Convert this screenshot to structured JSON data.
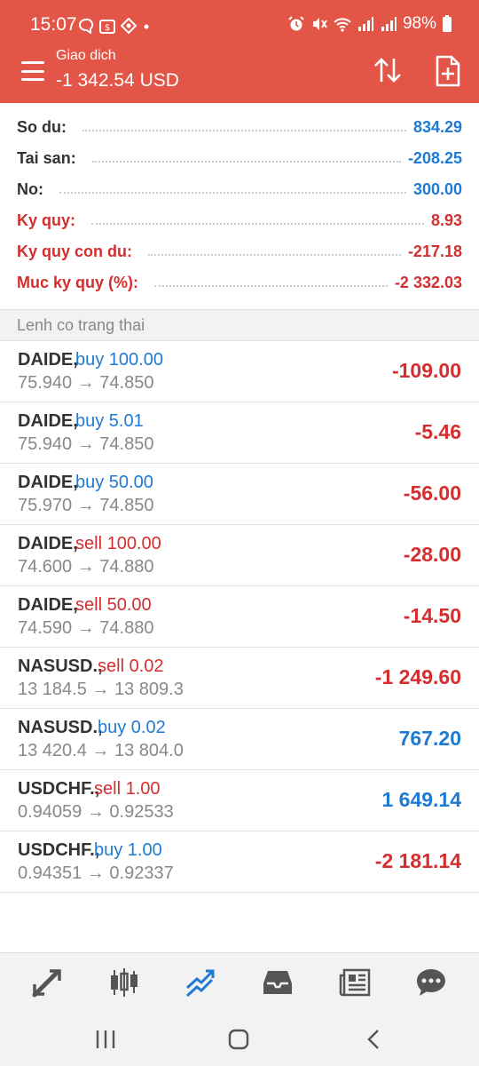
{
  "status_bar": {
    "time": "15:07",
    "battery": "98%",
    "left_icons": [
      "chat-bubble-icon",
      "dollar-app-icon",
      "sync-app-icon",
      "dot-icon"
    ],
    "right_icons": [
      "alarm-icon",
      "mute-icon",
      "wifi-icon",
      "signal-icon",
      "signal-icon",
      "battery-icon"
    ]
  },
  "header": {
    "title": "Giao dich",
    "subtitle": "-1 342.54 USD",
    "background": "#e35547"
  },
  "summary": [
    {
      "label": "So du:",
      "value": "834.29",
      "color": "blue"
    },
    {
      "label": "Tai san:",
      "value": "-208.25",
      "color": "blue"
    },
    {
      "label": "No:",
      "value": "300.00",
      "color": "blue"
    },
    {
      "label": "Ky quy:",
      "value": "8.93",
      "color": "red"
    },
    {
      "label": "Ky quy con du:",
      "value": "-217.18",
      "color": "red"
    },
    {
      "label": "Muc ky quy (%):",
      "value": "-2 332.03",
      "color": "red"
    }
  ],
  "section_title": "Lenh co trang thai",
  "positions": [
    {
      "symbol": "DAIDE,",
      "side": "buy",
      "volume": "buy 100.00",
      "prices": "75.940 → 74.850",
      "profit": "-109.00"
    },
    {
      "symbol": "DAIDE,",
      "side": "buy",
      "volume": "buy 5.01",
      "prices": "75.940 → 74.850",
      "profit": "-5.46"
    },
    {
      "symbol": "DAIDE,",
      "side": "buy",
      "volume": "buy 50.00",
      "prices": "75.970 → 74.850",
      "profit": "-56.00"
    },
    {
      "symbol": "DAIDE,",
      "side": "sell",
      "volume": "sell 100.00",
      "prices": "74.600 → 74.880",
      "profit": "-28.00"
    },
    {
      "symbol": "DAIDE,",
      "side": "sell",
      "volume": "sell 50.00",
      "prices": "74.590 → 74.880",
      "profit": "-14.50"
    },
    {
      "symbol": "NASUSD.,",
      "side": "sell",
      "volume": "sell 0.02",
      "prices": "13 184.5 → 13 809.3",
      "profit": "-1 249.60"
    },
    {
      "symbol": "NASUSD.,",
      "side": "buy",
      "volume": "buy 0.02",
      "prices": "13 420.4 → 13 804.0",
      "profit": "767.20"
    },
    {
      "symbol": "USDCHF.,",
      "side": "sell",
      "volume": "sell 1.00",
      "prices": "0.94059 → 0.92533",
      "profit": "1 649.14"
    },
    {
      "symbol": "USDCHF.,",
      "side": "buy",
      "volume": "buy 1.00",
      "prices": "0.94351 → 0.92337",
      "profit": "-2 181.14"
    }
  ],
  "bottom_nav": [
    {
      "name": "quotes-icon",
      "active": false
    },
    {
      "name": "chart-icon",
      "active": false
    },
    {
      "name": "trade-icon",
      "active": true
    },
    {
      "name": "history-inbox-icon",
      "active": false
    },
    {
      "name": "news-icon",
      "active": false
    },
    {
      "name": "messages-icon",
      "active": false
    }
  ],
  "system_nav": [
    "recent-apps-icon",
    "home-icon",
    "back-icon"
  ],
  "colors": {
    "accent": "#e35547",
    "blue": "#1f7ad4",
    "red": "#d42e2e",
    "muted": "#888888"
  }
}
